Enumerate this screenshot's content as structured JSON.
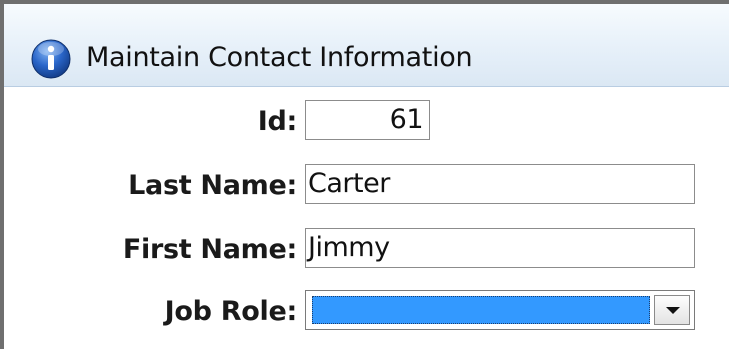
{
  "window": {
    "title": "Maintain Contact Information",
    "icon": "info-icon",
    "icon_color": "#1f5fc0"
  },
  "form": {
    "id": {
      "label": "Id:",
      "value": "61"
    },
    "last_name": {
      "label": "Last Name:",
      "value": "Carter"
    },
    "first_name": {
      "label": "First Name:",
      "value": "Jimmy"
    },
    "job_role": {
      "label": "Job Role:",
      "value": "",
      "selection_color": "#3399ff",
      "dropdown_icon": "chevron-down-icon"
    }
  }
}
